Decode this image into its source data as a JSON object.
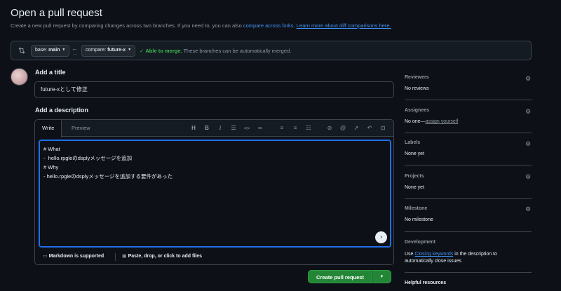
{
  "header": {
    "title": "Open a pull request",
    "subtitle_text": "Create a new pull request by comparing changes across two branches. If you need to, you can also ",
    "compare_forks_link": "compare across forks.",
    "learn_more_link": "Learn more about diff comparisons here."
  },
  "compare": {
    "base_prefix": "base:",
    "base_branch": "main",
    "compare_prefix": "compare:",
    "compare_branch": "future-x",
    "merge_ok": "Able to merge.",
    "merge_text": "These branches can be automatically merged."
  },
  "form": {
    "title_label": "Add a title",
    "title_value": "future-xとして修正",
    "description_label": "Add a description",
    "tab_write": "Write",
    "tab_preview": "Preview",
    "description_lines": [
      "# What",
      "-  hello.rpgleのdsplyメッセージを追加",
      "# Why",
      "- hello.rpgleのdsplyメッセージを追加する要件があった"
    ],
    "markdown_supported": "Markdown is supported",
    "attach_files": "Paste, drop, or click to add files",
    "create_button": "Create pull request"
  },
  "toolbar": {
    "heading": "H",
    "bold": "B",
    "italic": "I"
  },
  "sidebar": {
    "reviewers": {
      "title": "Reviewers",
      "value": "No reviews"
    },
    "assignees": {
      "title": "Assignees",
      "value": "No one—",
      "link": "assign yourself"
    },
    "labels": {
      "title": "Labels",
      "value": "None yet"
    },
    "projects": {
      "title": "Projects",
      "value": "None yet"
    },
    "milestone": {
      "title": "Milestone",
      "value": "No milestone"
    },
    "development": {
      "title": "Development",
      "text_before": "Use ",
      "link": "Closing keywords",
      "text_after": " in the description to",
      "line2": "automatically close issues"
    },
    "helpful": {
      "title": "Helpful resources"
    }
  },
  "colors": {
    "background": "#0d1117",
    "accent_green": "#238636",
    "link_blue": "#4493f8",
    "focus_blue": "#1f6feb"
  }
}
